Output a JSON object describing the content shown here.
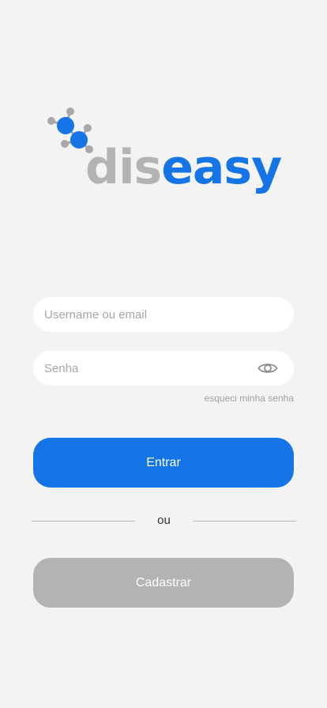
{
  "logo": {
    "part1": "dis",
    "part2": "easy",
    "colors": {
      "gray": "#b3b3b3",
      "blue": "#1575e6"
    },
    "icon": "molecule-icon"
  },
  "login": {
    "username_placeholder": "Username ou email",
    "username_value": "",
    "password_placeholder": "Senha",
    "password_value": "",
    "toggle_password_icon": "eye-icon",
    "forgot_password": "esqueci minha senha",
    "submit": "Entrar",
    "divider": "ou",
    "register": "Cadastrar"
  },
  "colors": {
    "background": "#f3f3f3",
    "primary": "#1575e6",
    "secondary": "#b3b3b3",
    "field": "#ffffff"
  }
}
